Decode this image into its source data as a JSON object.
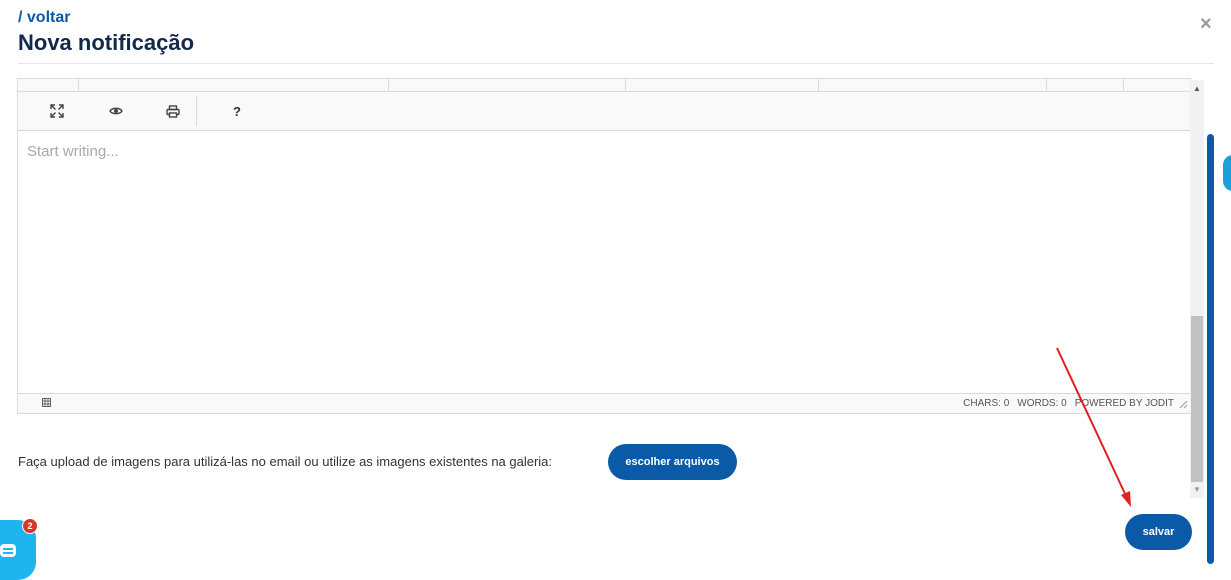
{
  "header": {
    "back_label": "/ voltar",
    "title": "Nova notificação",
    "close_label": "×"
  },
  "editor": {
    "toolbar": {
      "buttons": [
        {
          "name": "fullsize-icon"
        },
        {
          "name": "preview-icon"
        },
        {
          "name": "print-icon"
        },
        {
          "name": "help-icon",
          "label": "?"
        }
      ]
    },
    "placeholder": "Start writing...",
    "status": {
      "chars": "CHARS: 0",
      "words": "WORDS: 0",
      "powered": "POWERED BY JODIT"
    }
  },
  "upload": {
    "text": "Faça upload de imagens para utilizá-las no email ou utilize as imagens existentes na galeria:",
    "button_label": "escolher arquivos"
  },
  "actions": {
    "save_label": "salvar"
  },
  "chat": {
    "badge_count": "2"
  },
  "colors": {
    "primary": "#0b5aa8",
    "chat": "#1eb4ee",
    "badge": "#d13c29",
    "annotation_arrow": "#e0201e"
  }
}
